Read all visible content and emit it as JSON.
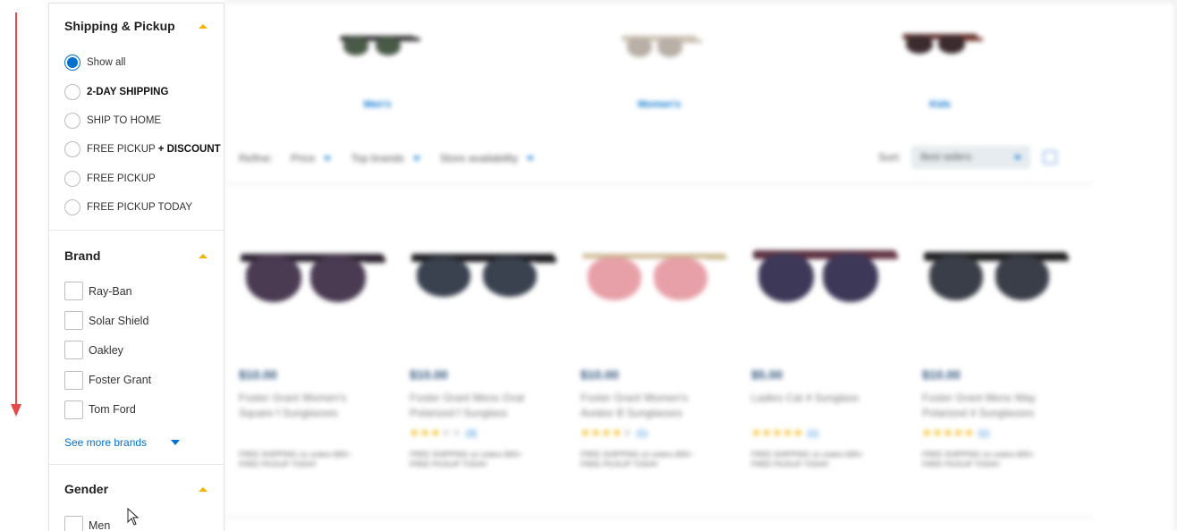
{
  "sidebar": {
    "shipping": {
      "title": "Shipping & Pickup",
      "options": [
        {
          "label": "Show all",
          "checked": true
        },
        {
          "label": "2-DAY SHIPPING",
          "checked": false
        },
        {
          "label": "SHIP TO HOME",
          "checked": false
        },
        {
          "label_prefix": "FREE PICKUP",
          "label_bold": "+ DISCOUNT",
          "checked": false
        },
        {
          "label": "FREE PICKUP",
          "checked": false
        },
        {
          "label": "FREE PICKUP TODAY",
          "checked": false
        }
      ]
    },
    "brand": {
      "title": "Brand",
      "items": [
        "Ray-Ban",
        "Solar Shield",
        "Oakley",
        "Foster Grant",
        "Tom Ford"
      ],
      "see_more": "See more brands"
    },
    "gender": {
      "title": "Gender",
      "items": [
        "Men"
      ]
    }
  },
  "main": {
    "categories": [
      "Men's",
      "Women's",
      "Kids"
    ],
    "refine": {
      "label": "Refine:",
      "filters": [
        "Price",
        "Top brands",
        "Store availability"
      ]
    },
    "sort": {
      "label": "Sort:",
      "value": "Best sellers"
    },
    "products": [
      {
        "price": "$10.00",
        "title_line1": "Foster Grant Women's",
        "title_line2": "Square f Sunglasses",
        "rating": 0,
        "reviews": "",
        "ship1": "FREE SHIPPING on orders $35+",
        "ship2": "FREE PICKUP TODAY"
      },
      {
        "price": "$10.00",
        "title_line1": "Foster Grant Mens Oval",
        "title_line2": "Polarized f Sunglass",
        "rating": 3.5,
        "reviews": "(3)",
        "ship1": "FREE SHIPPING on orders $35+",
        "ship2": "FREE PICKUP TODAY"
      },
      {
        "price": "$10.00",
        "title_line1": "Foster Grant Women's",
        "title_line2": "Aviator B Sunglasses",
        "rating": 4,
        "reviews": "(1)",
        "ship1": "FREE SHIPPING on orders $35+",
        "ship2": "FREE PICKUP TODAY"
      },
      {
        "price": "$5.00",
        "title_line1": "Ladies Cat 4 Sunglass",
        "title_line2": "",
        "rating": 5,
        "reviews": "(1)",
        "ship1": "FREE SHIPPING on orders $35+",
        "ship2": "FREE PICKUP TODAY"
      },
      {
        "price": "$10.00",
        "title_line1": "Foster Grant Mens Way",
        "title_line2": "Polarized 4 Sunglasses",
        "rating": 5,
        "reviews": "(1)",
        "ship1": "FREE SHIPPING on orders $35+",
        "ship2": "FREE PICKUP TODAY"
      }
    ]
  },
  "colors": {
    "accent": "#0071ce",
    "caret": "#f2b400",
    "annotation_arrow": "#e8484a",
    "price": "#2a4f7a"
  }
}
